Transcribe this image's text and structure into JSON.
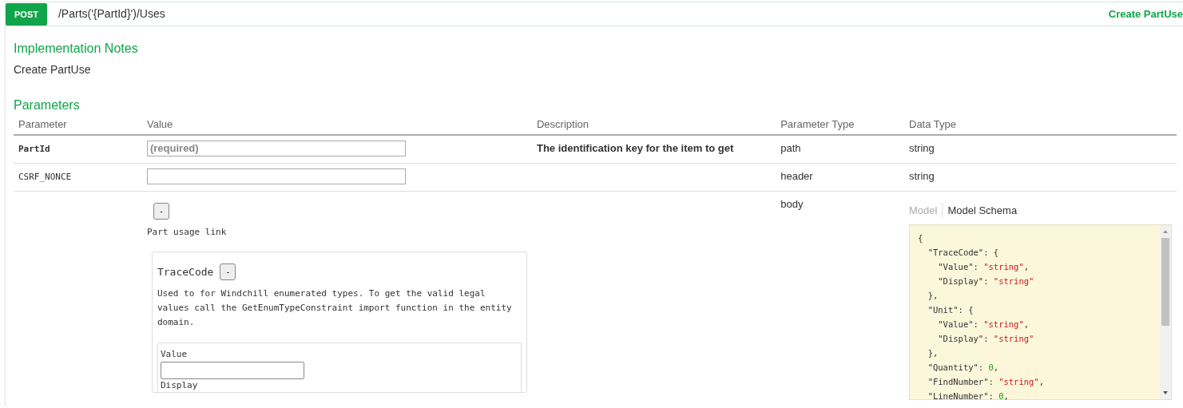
{
  "operation": {
    "method": "POST",
    "path": "/Parts('{PartId}')/Uses",
    "summary": "Create PartUse"
  },
  "implementation_notes": {
    "heading": "Implementation Notes",
    "text": "Create PartUse"
  },
  "parameters": {
    "heading": "Parameters",
    "columns": [
      "Parameter",
      "Value",
      "Description",
      "Parameter Type",
      "Data Type"
    ],
    "rows": [
      {
        "kind": "field",
        "name": "PartId",
        "required": true,
        "placeholder": "(required)",
        "description": "The identification key for the item to get",
        "param_type": "path",
        "data_type": "string"
      },
      {
        "kind": "field",
        "name": "CSRF_NONCE",
        "required": false,
        "param_type": "header",
        "data_type": "string"
      },
      {
        "kind": "body",
        "param_type": "body",
        "editor": {
          "toggle": "-",
          "title": "Part usage link",
          "property": {
            "name": "TraceCode",
            "toggle": "-",
            "description": "Used to for Windchill enumerated types. To get the valid legal values call the GetEnumTypeConstraint import function in the entity domain.",
            "fields": [
              "Value",
              "Display"
            ]
          }
        },
        "model_tabs": [
          {
            "label": "Model",
            "selected": false
          },
          {
            "label": "Model Schema",
            "selected": true
          }
        ],
        "model_lines": [
          [
            {
              "kind": "punct",
              "text": "{"
            }
          ],
          [
            {
              "kind": "key",
              "text": "  \"TraceCode\": {"
            }
          ],
          [
            {
              "kind": "key",
              "text": "    \"Value\": "
            },
            {
              "kind": "string",
              "text": "\"string\""
            },
            {
              "kind": "punct",
              "text": ","
            }
          ],
          [
            {
              "kind": "key",
              "text": "    \"Display\": "
            },
            {
              "kind": "string",
              "text": "\"string\""
            }
          ],
          [
            {
              "kind": "punct",
              "text": "  },"
            }
          ],
          [
            {
              "kind": "key",
              "text": "  \"Unit\": {"
            }
          ],
          [
            {
              "kind": "key",
              "text": "    \"Value\": "
            },
            {
              "kind": "string",
              "text": "\"string\""
            },
            {
              "kind": "punct",
              "text": ","
            }
          ],
          [
            {
              "kind": "key",
              "text": "    \"Display\": "
            },
            {
              "kind": "string",
              "text": "\"string\""
            }
          ],
          [
            {
              "kind": "punct",
              "text": "  },"
            }
          ],
          [
            {
              "kind": "key",
              "text": "  \"Quantity\": "
            },
            {
              "kind": "number",
              "text": "0"
            },
            {
              "kind": "punct",
              "text": ","
            }
          ],
          [
            {
              "kind": "key",
              "text": "  \"FindNumber\": "
            },
            {
              "kind": "string",
              "text": "\"string\""
            },
            {
              "kind": "punct",
              "text": ","
            }
          ],
          [
            {
              "kind": "key",
              "text": "  \"LineNumber\": "
            },
            {
              "kind": "number",
              "text": "0"
            },
            {
              "kind": "punct",
              "text": ","
            }
          ]
        ]
      }
    ]
  }
}
